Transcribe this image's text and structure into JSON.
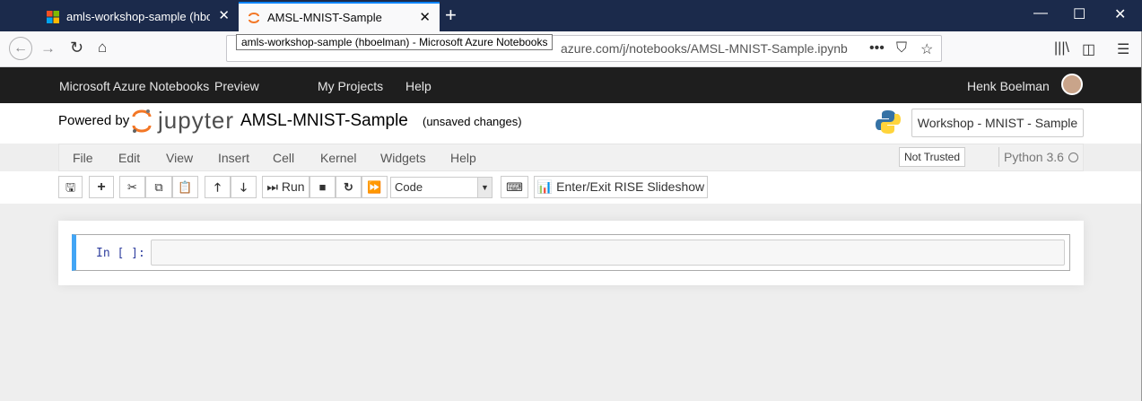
{
  "browser": {
    "tabs": [
      {
        "title": "amls-workshop-sample (hboel"
      },
      {
        "title": "AMSL-MNIST-Sample"
      }
    ],
    "url": "https://...azure.com/j/notebooks/AMSL-MNIST-Sample.ipynb",
    "url_visible_tail": "azure.com/j/notebooks/AMSL-MNIST-Sample.ipynb",
    "tooltip": "amls-workshop-sample (hboelman) - Microsoft Azure Notebooks"
  },
  "azure": {
    "brand": "Microsoft Azure Notebooks",
    "preview": "Preview",
    "my_projects": "My Projects",
    "help": "Help",
    "user": "Henk Boelman"
  },
  "jupyter": {
    "powered_by": "Powered by",
    "logo_text": "jupyter",
    "notebook_name": "AMSL-MNIST-Sample",
    "unsaved": "(unsaved changes)",
    "kernel_button": "Workshop - MNIST - Sample",
    "menu": [
      "File",
      "Edit",
      "View",
      "Insert",
      "Cell",
      "Kernel",
      "Widgets",
      "Help"
    ],
    "trusted": "Not Trusted",
    "kernel_name": "Python 3.6",
    "run_label": "Run",
    "cell_type": "Code",
    "rise_label": "Enter/Exit RISE Slideshow",
    "prompt": "In [ ]:"
  }
}
